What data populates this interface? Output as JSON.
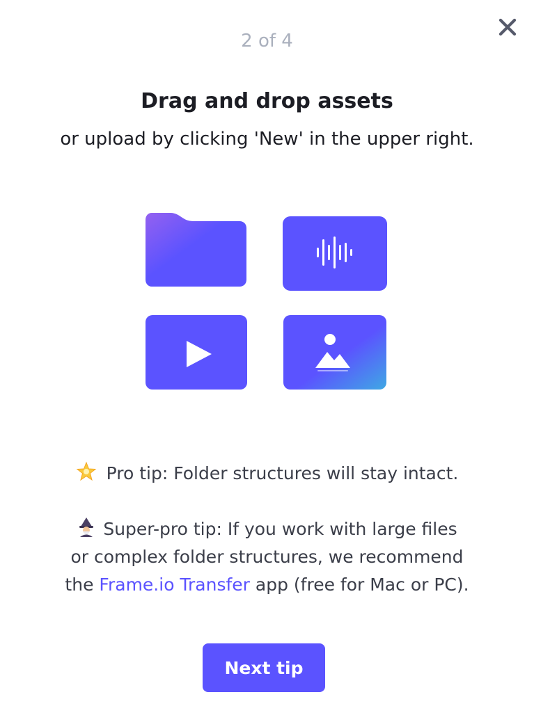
{
  "header": {
    "step": "2 of 4",
    "close_icon": "close-icon"
  },
  "main": {
    "title": "Drag and drop assets",
    "subtitle": "or upload by clicking 'New' in the upper right."
  },
  "illustration": {
    "tiles": [
      {
        "icon": "folder-icon"
      },
      {
        "icon": "audio-waveform-icon"
      },
      {
        "icon": "video-play-icon"
      },
      {
        "icon": "image-icon"
      }
    ]
  },
  "tips": {
    "pro_tip_emoji": "glowing-star-icon",
    "pro_tip": "Pro tip: Folder structures will stay intact.",
    "super_pro_emoji": "mage-icon",
    "super_pro_line1": "Super-pro tip: If you work with large files",
    "super_pro_line2": "or complex folder structures, we recommend",
    "super_pro_line3_prefix": "the ",
    "super_pro_link": "Frame.io Transfer",
    "super_pro_line3_suffix": " app (free for Mac or PC)."
  },
  "footer": {
    "next_label": "Next tip"
  },
  "colors": {
    "accent": "#5b53ff",
    "muted_text": "#aab0bd",
    "body_text": "#3b3e49"
  }
}
